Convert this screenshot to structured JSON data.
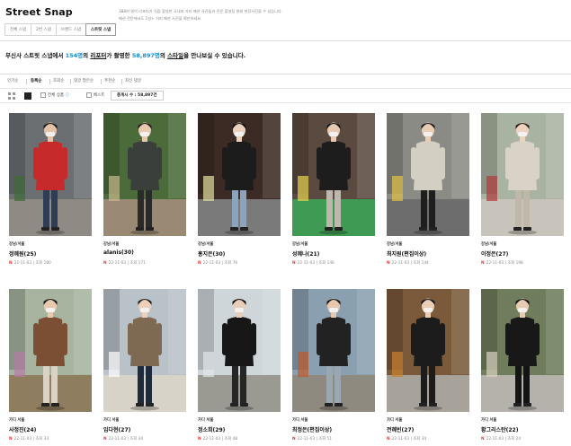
{
  "header": {
    "title": "Street Snap",
    "desc_line1": "388여 명의 리포터가 직접 촬영한 국내외 거리 패션 사진들과 전문 촬영팀 원레 현장사진을 수 있습니다.",
    "desc_line2": "패션 전문에서도 1일+ 거리 패션 사진을 확인하세요."
  },
  "tabs": [
    {
      "label": "전체 스냅",
      "active": false
    },
    {
      "label": "2번 스냅",
      "active": false
    },
    {
      "label": "브랜드 스냅",
      "active": false
    },
    {
      "label": "스트릿 스냅",
      "active": true
    }
  ],
  "summary": {
    "pre": "무신사 스트릿 스냅에서 ",
    "reporters": "154명",
    "mid1": "의 ",
    "reporter_word": "리포터",
    "mid2": "가 촬영한 ",
    "styles": "58,897명",
    "mid3": "의 ",
    "style_word": "스타일",
    "post": "을 만나보실 수 있습니다."
  },
  "sort": [
    {
      "label": "인기순",
      "active": false
    },
    {
      "label": "등록순",
      "active": true
    },
    {
      "label": "조회순",
      "active": false
    },
    {
      "label": "댓글 많은순",
      "active": false
    },
    {
      "label": "추천순",
      "active": false
    },
    {
      "label": "최신 댓글",
      "active": false
    }
  ],
  "filters": {
    "all_label": "전체 상품",
    "best_label": "베스트",
    "count_text": "총게시 수 : 58,897건"
  },
  "cards": [
    {
      "category": "강남/서울",
      "name": "정혜원(25)",
      "date": "22-11-03",
      "views": "조회 180",
      "scene": {
        "bg": "#6b6f72",
        "ground": "#8f8b84",
        "top": "#c62a2a",
        "bottom": "#2f3c55",
        "skin": "#e4c3a8",
        "hair": "#1a1a1a",
        "accent": "#3f6a36"
      }
    },
    {
      "category": "강남/서울",
      "name": "alanis(30)",
      "date": "22-11-03",
      "views": "조회 171",
      "scene": {
        "bg": "#4b6b3a",
        "ground": "#9a8a73",
        "top": "#3a3f3b",
        "bottom": "#2a2a2a",
        "skin": "#e8c9b0",
        "hair": "#2a1f18",
        "accent": "#c9b98f"
      }
    },
    {
      "category": "강남/서울",
      "name": "홍지은(30)",
      "date": "22-11-03",
      "views": "조회 76",
      "scene": {
        "bg": "#3c2b24",
        "ground": "#7a7a7a",
        "top": "#1c1c1c",
        "bottom": "#8ba3bd",
        "skin": "#ecd2bd",
        "hair": "#111111",
        "accent": "#e4e0a0"
      }
    },
    {
      "category": "강남/서울",
      "name": "성혜나(21)",
      "date": "22-11-03",
      "views": "조회 146",
      "scene": {
        "bg": "#5b4a3f",
        "ground": "#3f9a54",
        "top": "#1d1d1d",
        "bottom": "#bdb7ad",
        "skin": "#e6c9b2",
        "hair": "#141414",
        "accent": "#e8d34f"
      }
    },
    {
      "category": "강남/서울",
      "name": "최지원(편집이상)",
      "date": "22-11-03",
      "views": "조회 144",
      "scene": {
        "bg": "#8b8b86",
        "ground": "#6d6d6d",
        "top": "#d4cfc3",
        "bottom": "#1e1e1e",
        "skin": "#e9ccb4",
        "hair": "#1b1b1b",
        "accent": "#e0c244"
      }
    },
    {
      "category": "강남/서울",
      "name": "이정은(27)",
      "date": "22-11-03",
      "views": "조회 198",
      "scene": {
        "bg": "#a9b3a2",
        "ground": "#c9c4bb",
        "top": "#d9d2c6",
        "bottom": "#bfb7a8",
        "skin": "#ecd3c0",
        "hair": "#2b1e16",
        "accent": "#b03a3a"
      }
    },
    {
      "category": "가디 서울",
      "name": "사정진(24)",
      "date": "22-11-03",
      "views": "조회 33",
      "scene": {
        "bg": "#a6b4a0",
        "ground": "#8e7d5e",
        "top": "#7a4f33",
        "bottom": "#d9d2c5",
        "skin": "#e8c9ae",
        "hair": "#161616",
        "accent": "#b77ba6"
      }
    },
    {
      "category": "가디 서울",
      "name": "임다현(27)",
      "date": "22-11-03",
      "views": "조회 34",
      "scene": {
        "bg": "#b9c2c8",
        "ground": "#d8d3c9",
        "top": "#7e6a52",
        "bottom": "#1f2a3b",
        "skin": "#ecd0bb",
        "hair": "#1d1d1d",
        "accent": "#ffffff"
      }
    },
    {
      "category": "가디 서울",
      "name": "정소희(29)",
      "date": "22-11-03",
      "views": "조회 48",
      "scene": {
        "bg": "#cfd6da",
        "ground": "#9a9a92",
        "top": "#171717",
        "bottom": "#262626",
        "skin": "#e8cdb8",
        "hair": "#121212",
        "accent": "#dfe6ea"
      }
    },
    {
      "category": "가디 서울",
      "name": "최정은(편집이상)",
      "date": "22-11-03",
      "views": "조회 51",
      "scene": {
        "bg": "#8aa0b0",
        "ground": "#8f8a7f",
        "top": "#222222",
        "bottom": "#9aa6b0",
        "skin": "#e6c8ae",
        "hair": "#151515",
        "accent": "#c05a2b"
      }
    },
    {
      "category": "가디 서울",
      "name": "전혜빈(27)",
      "date": "22-11-03",
      "views": "조회 34",
      "scene": {
        "bg": "#7a5a3b",
        "ground": "#a8a39a",
        "top": "#1c1c1c",
        "bottom": "#1c1c1c",
        "skin": "#e9cdb5",
        "hair": "#111111",
        "accent": "#c9822e"
      }
    },
    {
      "category": "가디 서울",
      "name": "황그리스탄(22)",
      "date": "22-11-03",
      "views": "조회 24",
      "scene": {
        "bg": "#6f7d5c",
        "ground": "#b5b2ab",
        "top": "#181818",
        "bottom": "#141414",
        "skin": "#e7cbb3",
        "hair": "#0f0f0f",
        "accent": "#d8d2c2"
      }
    }
  ]
}
